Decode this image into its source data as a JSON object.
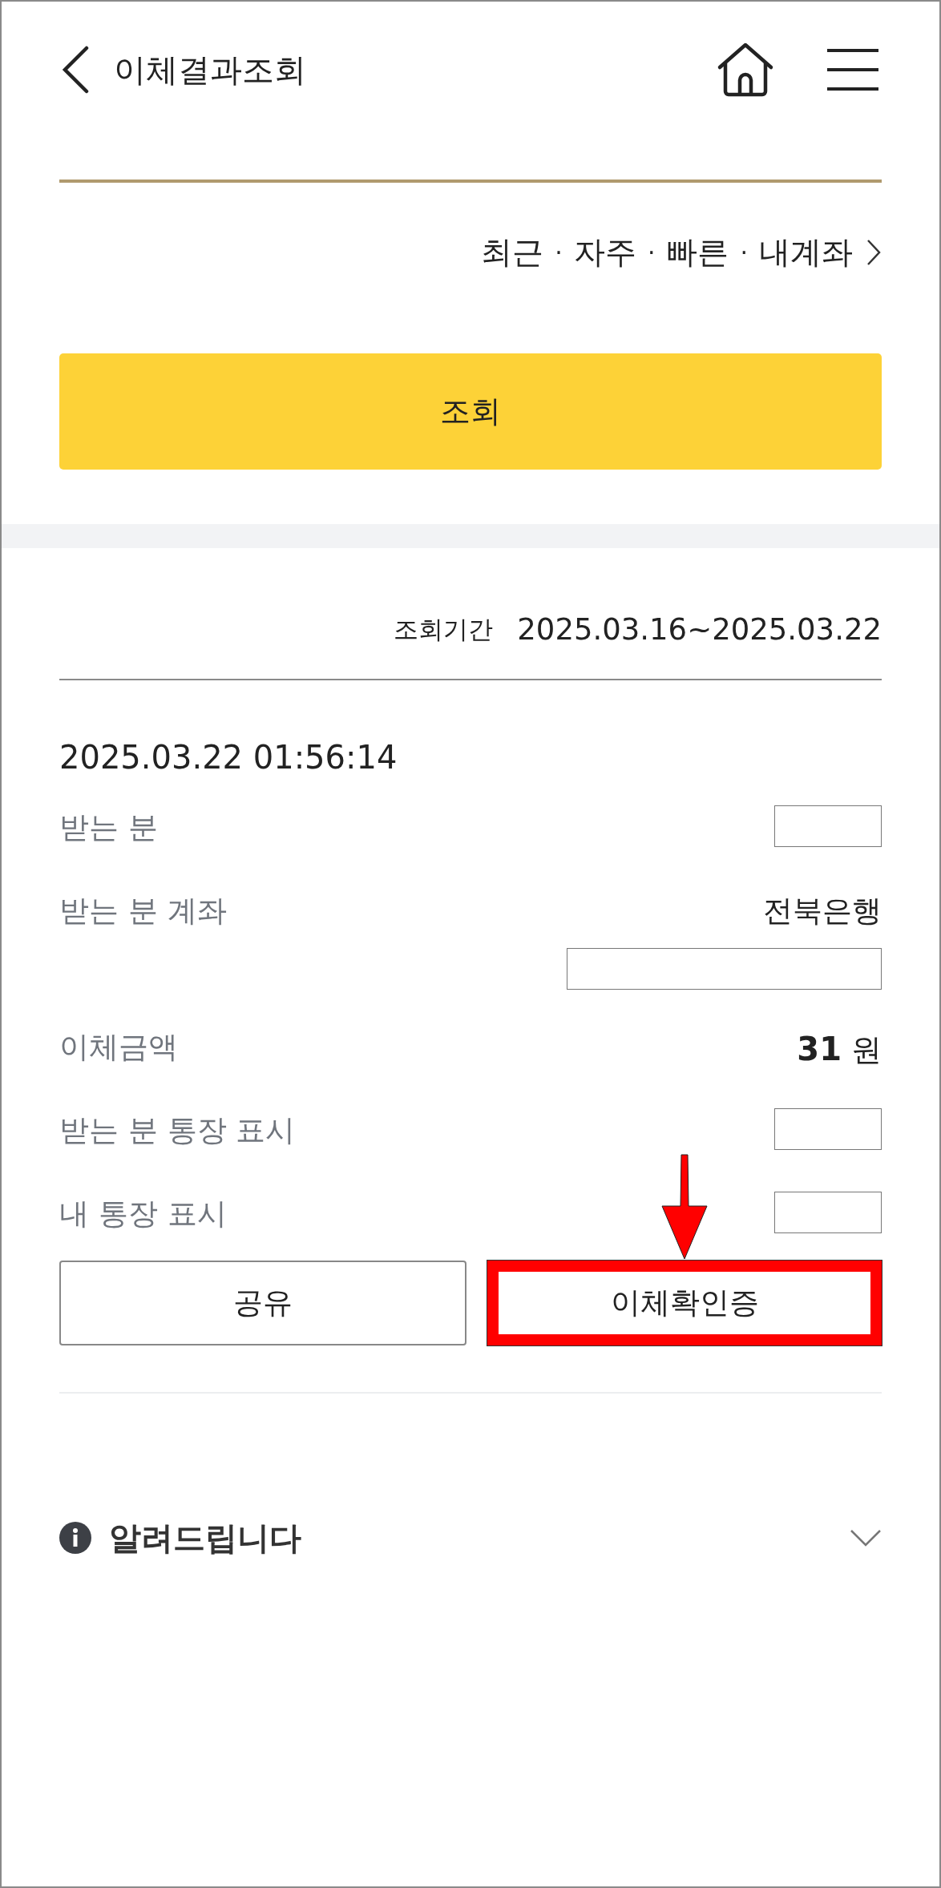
{
  "header": {
    "title": "이체결과조회"
  },
  "shortcuts": {
    "items": [
      "최근",
      "자주",
      "빠른",
      "내계좌"
    ],
    "separator": "·"
  },
  "search_button": {
    "label": "조회"
  },
  "period": {
    "label": "조회기간",
    "value": "2025.03.16~2025.03.22"
  },
  "result": {
    "datetime": "2025.03.22 01:56:14",
    "rows": [
      {
        "label": "받는 분",
        "kind": "redacted"
      },
      {
        "label": "받는 분 계좌",
        "kind": "text_redacted",
        "value": "전북은행"
      },
      {
        "label": "이체금액",
        "kind": "amount",
        "value": "31",
        "unit": "원"
      },
      {
        "label": "받는 분 통장 표시",
        "kind": "redacted"
      },
      {
        "label": "내 통장 표시",
        "kind": "redacted"
      }
    ],
    "buttons": [
      {
        "label": "공유",
        "highlighted": false
      },
      {
        "label": "이체확인증",
        "highlighted": true
      }
    ]
  },
  "notice": {
    "title": "알려드립니다",
    "expanded": false
  }
}
